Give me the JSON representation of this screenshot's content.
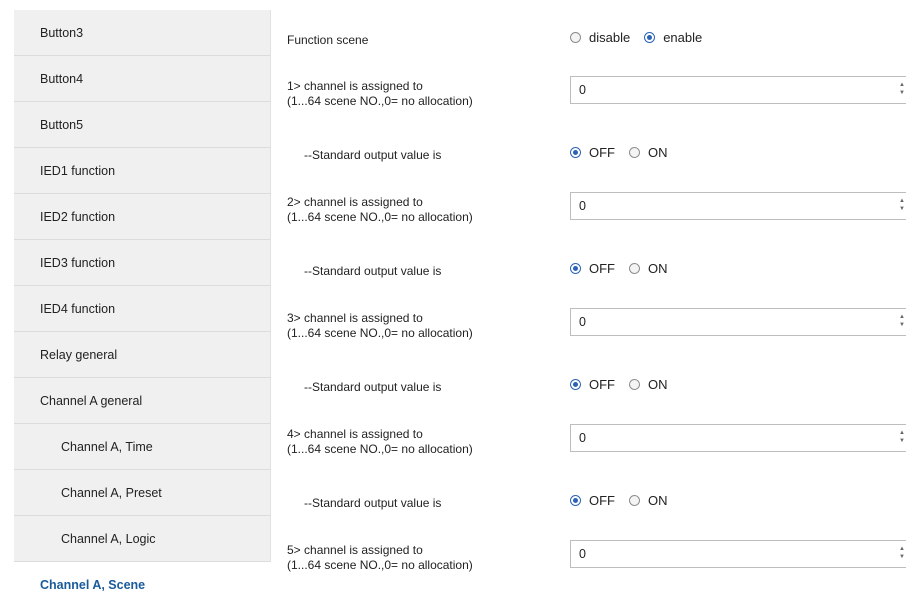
{
  "sidebar": {
    "items": [
      {
        "label": "Button3"
      },
      {
        "label": "Button4"
      },
      {
        "label": "Button5"
      },
      {
        "label": "IED1 function"
      },
      {
        "label": "IED2 function"
      },
      {
        "label": "IED3 function"
      },
      {
        "label": "IED4 function"
      },
      {
        "label": "Relay general"
      },
      {
        "label": "Channel A general"
      },
      {
        "label": "Channel A, Time"
      },
      {
        "label": "Channel A, Preset"
      },
      {
        "label": "Channel A, Logic"
      },
      {
        "label": "Channel A, Scene"
      }
    ]
  },
  "main": {
    "function_scene": {
      "label": "Function scene",
      "options": [
        "disable",
        "enable"
      ],
      "selected": "enable"
    },
    "channels": [
      {
        "assign_label": "1> channel is assigned to",
        "assign_sub": "(1...64 scene NO.,0= no allocation)",
        "value": "0",
        "output_label": "--Standard output value is",
        "options": [
          "OFF",
          "ON"
        ],
        "selected": "OFF"
      },
      {
        "assign_label": "2> channel is assigned to",
        "assign_sub": "(1...64 scene NO.,0= no allocation)",
        "value": "0",
        "output_label": "--Standard output value is",
        "options": [
          "OFF",
          "ON"
        ],
        "selected": "OFF"
      },
      {
        "assign_label": "3> channel is assigned to",
        "assign_sub": "(1...64 scene NO.,0= no allocation)",
        "value": "0",
        "output_label": "--Standard output value is",
        "options": [
          "OFF",
          "ON"
        ],
        "selected": "OFF"
      },
      {
        "assign_label": "4> channel is assigned to",
        "assign_sub": "(1...64 scene NO.,0= no allocation)",
        "value": "0",
        "output_label": "--Standard output value is",
        "options": [
          "OFF",
          "ON"
        ],
        "selected": "OFF"
      },
      {
        "assign_label": "5> channel is assigned to",
        "assign_sub": "(1...64 scene NO.,0= no allocation)",
        "value": "0"
      }
    ]
  },
  "colors": {
    "active_link": "#1a5a9b",
    "radio_selected": "#2b64b5",
    "sidebar_bg": "#f0f0f0"
  }
}
